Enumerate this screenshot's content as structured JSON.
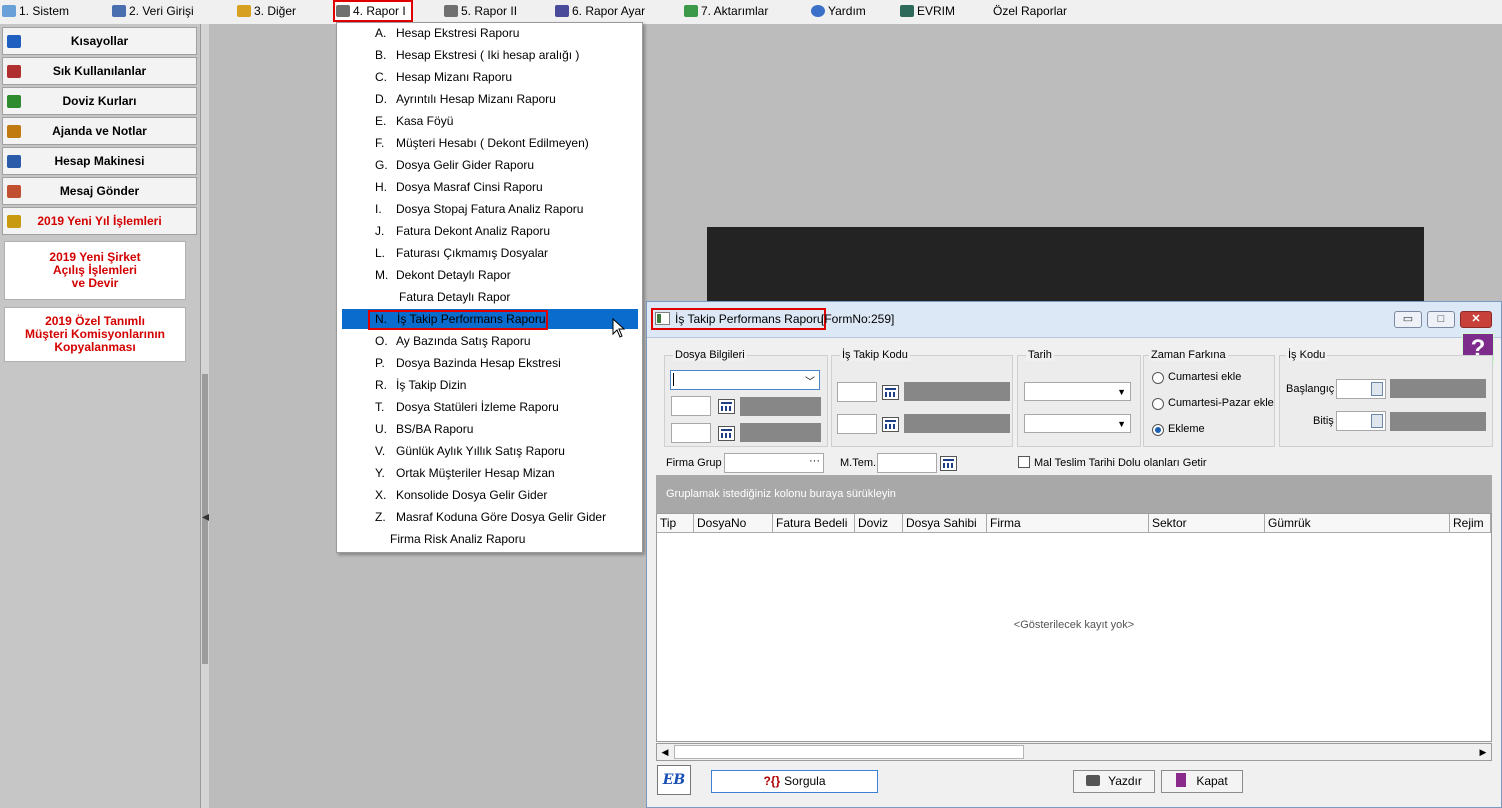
{
  "menubar": {
    "items": [
      {
        "label": "1.  Sistem",
        "icon": "system-icon"
      },
      {
        "label": "2.  Veri Girişi",
        "icon": "data-entry-icon"
      },
      {
        "label": "3.  Diğer",
        "icon": "other-icon"
      },
      {
        "label": "4.  Rapor I",
        "icon": "report-printer-icon"
      },
      {
        "label": "5.  Rapor II",
        "icon": "report2-printer-icon"
      },
      {
        "label": "6.  Rapor Ayar",
        "icon": "report-settings-icon"
      },
      {
        "label": "7.  Aktarımlar",
        "icon": "transfers-icon"
      },
      {
        "label": "Yardım",
        "icon": "help-icon"
      },
      {
        "label": "EVRIM",
        "icon": "evrim-icon"
      },
      {
        "label": "Özel Raporlar"
      }
    ]
  },
  "sidebar": {
    "items": [
      {
        "label": "Kısayollar",
        "icon": "shortcuts-icon",
        "color": "#1f5fbf"
      },
      {
        "label": "Sık Kullanılanlar",
        "icon": "favorites-icon",
        "color": "#b03030"
      },
      {
        "label": "Doviz Kurları",
        "icon": "currency-icon",
        "color": "#2e8b2e"
      },
      {
        "label": "Ajanda ve Notlar",
        "icon": "agenda-icon",
        "color": "#c07a10"
      },
      {
        "label": "Hesap Makinesi",
        "icon": "calculator-icon",
        "color": "#2a5caa"
      },
      {
        "label": "Mesaj Gönder",
        "icon": "message-icon",
        "color": "#c05030"
      },
      {
        "label": "2019 Yeni Yıl İşlemleri",
        "icon": "scales-icon",
        "color": "#c79a10"
      }
    ],
    "big_buttons": [
      {
        "label": "2019 Yeni Şirket\nAçılış İşlemleri\nve Devir"
      },
      {
        "label": "2019 Özel Tanımlı\nMüşteri Komisyonlarının\nKopyalanması"
      }
    ]
  },
  "dropdown": {
    "items": [
      {
        "key": "A.",
        "label": "Hesap Ekstresi Raporu"
      },
      {
        "key": "B.",
        "label": "Hesap Ekstresi ( Iki hesap aralığı )"
      },
      {
        "key": "C.",
        "label": "Hesap Mizanı Raporu"
      },
      {
        "key": "D.",
        "label": "Ayrıntılı Hesap Mizanı Raporu"
      },
      {
        "key": "E.",
        "label": "Kasa Föyü"
      },
      {
        "key": "F.",
        "label": "Müşteri Hesabı ( Dekont Edilmeyen)"
      },
      {
        "key": "G.",
        "label": "Dosya Gelir Gider Raporu"
      },
      {
        "key": "H.",
        "label": "Dosya Masraf Cinsi Raporu"
      },
      {
        "key": "I.",
        "label": "Dosya Stopaj Fatura Analiz Raporu"
      },
      {
        "key": "J.",
        "label": "Fatura Dekont Analiz Raporu"
      },
      {
        "key": "L.",
        "label": "Faturası Çıkmamış Dosyalar"
      },
      {
        "key": "M.",
        "label": "Dekont Detaylı Rapor"
      },
      {
        "key": "",
        "label": "Fatura Detaylı Rapor"
      },
      {
        "key": "N.",
        "label": "İş Takip Performans Raporu"
      },
      {
        "key": "O.",
        "label": "Ay Bazında Satış Raporu"
      },
      {
        "key": "P.",
        "label": "Dosya Bazinda Hesap Ekstresi"
      },
      {
        "key": "R.",
        "label": "İş Takip Dizin"
      },
      {
        "key": "T.",
        "label": "Dosya Statüleri İzleme Raporu"
      },
      {
        "key": "U.",
        "label": "BS/BA Raporu"
      },
      {
        "key": "V.",
        "label": "Günlük Aylık Yıllık Satış Raporu"
      },
      {
        "key": "Y.",
        "label": "Ortak Müşteriler Hesap Mizan"
      },
      {
        "key": "X.",
        "label": "Konsolide Dosya Gelir Gider"
      },
      {
        "key": "Z.",
        "label": "Masraf Koduna Göre Dosya Gelir Gider"
      },
      {
        "key": "",
        "label": "Firma Risk Analiz Raporu"
      }
    ],
    "selected_index": 13
  },
  "form": {
    "title": "İş Takip Performans Raporu",
    "form_no": "[FormNo:259]",
    "help_label": "?",
    "window_buttons": {
      "minimize": "▭",
      "maximize": "□",
      "close": "✕"
    },
    "groups": {
      "dosya_bilgileri": "Dosya Bilgileri",
      "is_takip_kodu": "İş Takip Kodu",
      "tarih": "Tarih",
      "zaman_farkina": "Zaman Farkına",
      "is_kodu": "İş Kodu"
    },
    "radio": {
      "options": [
        "Cumartesi ekle",
        "Cumartesi-Pazar ekle",
        "Ekleme"
      ],
      "selected": "Ekleme"
    },
    "is_kodu_labels": {
      "start": "Başlangıç",
      "end": "Bitiş"
    },
    "firma_grup_label": "Firma Grup",
    "firma_grup_btn": "···",
    "mtem_label": "M.Tem.",
    "checkbox_label": "Mal Teslim Tarihi Dolu olanları Getir",
    "group_hint": "Gruplamak istediğiniz kolonu buraya sürükleyin",
    "columns": [
      "Tip",
      "DosyaNo",
      "Fatura Bedeli",
      "Doviz",
      "Dosya Sahibi",
      "Firma",
      "Sektor",
      "Gümrük",
      "Rejim"
    ],
    "no_data": "<Gösterilecek kayıt yok>",
    "buttons": {
      "query": "Sorgula",
      "query_icon": "?{}",
      "print": "Yazdır",
      "close": "Kapat",
      "logo": "EB"
    }
  }
}
